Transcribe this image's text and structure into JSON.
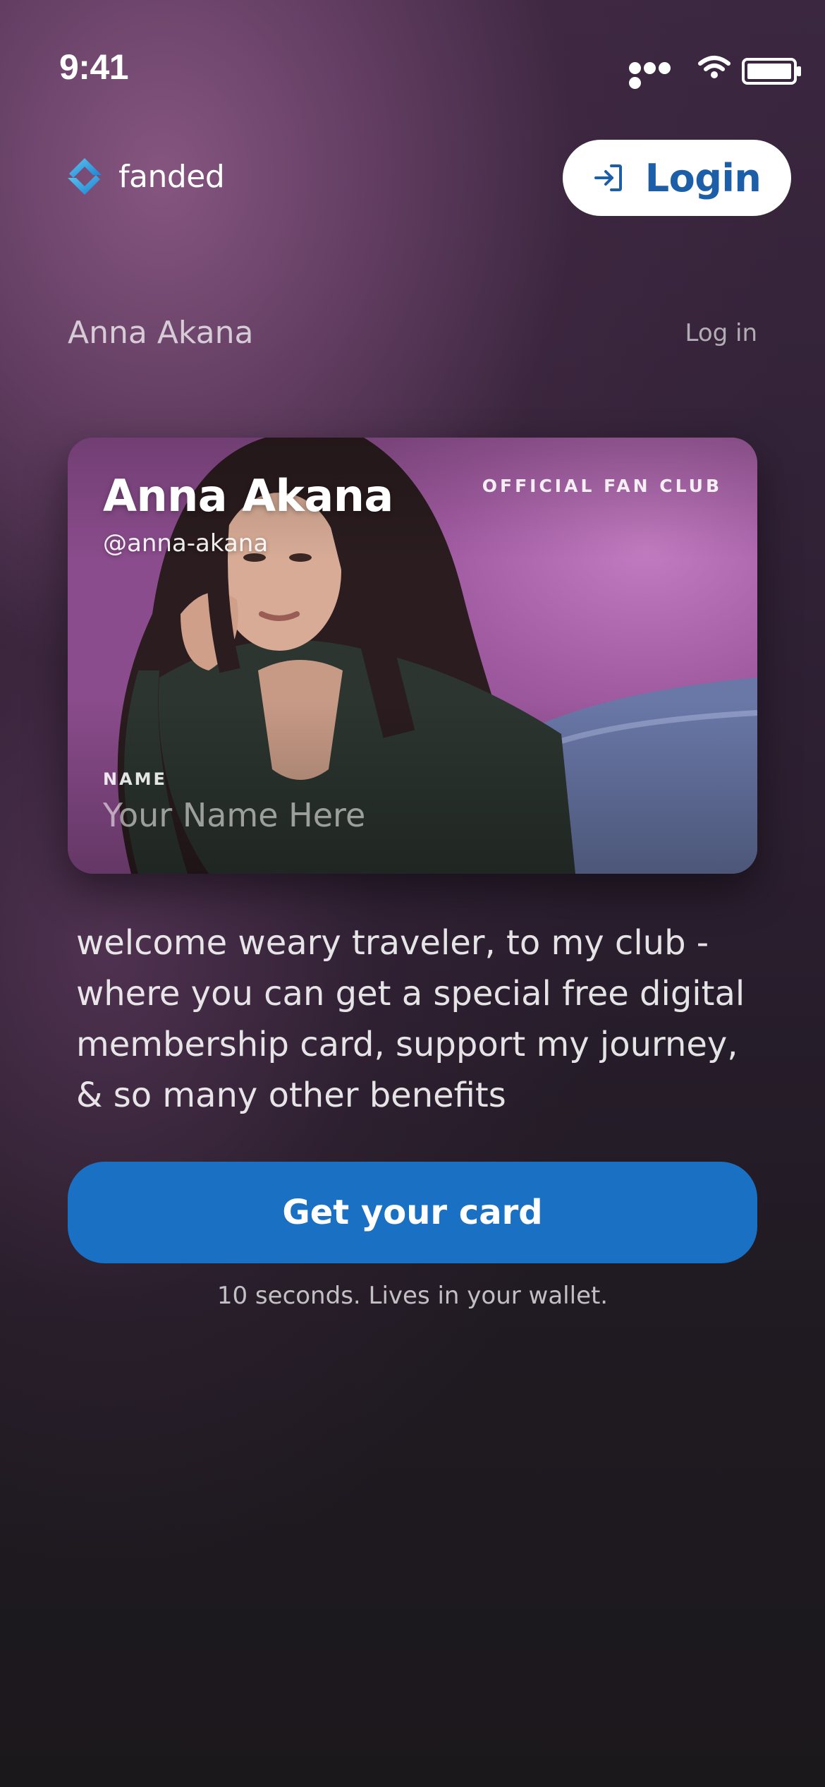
{
  "status_bar": {
    "time": "9:41",
    "icons": [
      "cellular-signal-icon",
      "wifi-icon",
      "battery-icon"
    ]
  },
  "header": {
    "logo_text": "fanded",
    "logo_icon": "fanded-logo-icon",
    "login_button": {
      "label": "Login",
      "icon": "login-arrow-icon"
    }
  },
  "subheader": {
    "creator_name": "Anna Akana",
    "login_link": "Log in"
  },
  "card": {
    "name": "Anna Akana",
    "handle": "@anna-akana",
    "tag": "OFFICIAL FAN CLUB",
    "field_label": "NAME",
    "field_placeholder": "Your Name Here"
  },
  "description": "welcome weary traveler, to my club - where you can get a special free digital membership card, support my journey, & so many other benefits",
  "cta": {
    "label": "Get your card",
    "caption": "10 seconds. Lives in your wallet."
  },
  "colors": {
    "accent_blue": "#1a70c2",
    "login_text": "#1c5fa8",
    "card_pink": "#b96fb8"
  }
}
